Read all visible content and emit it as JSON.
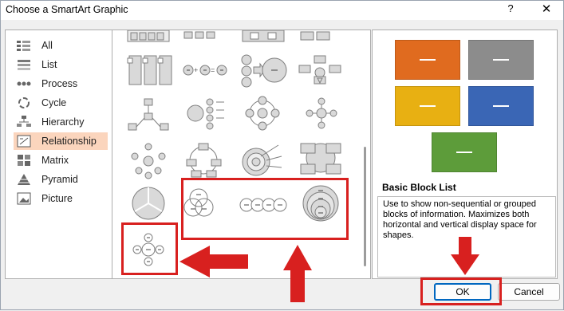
{
  "window": {
    "title": "Choose a SmartArt Graphic",
    "help_glyph": "?",
    "close_glyph": "✕"
  },
  "categories": [
    {
      "label": "All",
      "icon": "all-icon"
    },
    {
      "label": "List",
      "icon": "list-icon"
    },
    {
      "label": "Process",
      "icon": "process-icon"
    },
    {
      "label": "Cycle",
      "icon": "cycle-icon"
    },
    {
      "label": "Hierarchy",
      "icon": "hierarchy-icon"
    },
    {
      "label": "Relationship",
      "icon": "relationship-icon",
      "selected": true
    },
    {
      "label": "Matrix",
      "icon": "matrix-icon"
    },
    {
      "label": "Pyramid",
      "icon": "pyramid-icon"
    },
    {
      "label": "Picture",
      "icon": "picture-icon"
    }
  ],
  "preview": {
    "title": "Basic Block List",
    "description": "Use to show non-sequential or grouped blocks of information. Maximizes both horizontal and vertical display space for shapes.",
    "block_colors": [
      "#e06b1f",
      "#8c8c8c",
      "#e8b012",
      "#3a66b5",
      "#5d9c3a"
    ]
  },
  "buttons": {
    "ok": "OK",
    "cancel": "Cancel"
  },
  "annotation": {
    "color": "#d8201f"
  }
}
